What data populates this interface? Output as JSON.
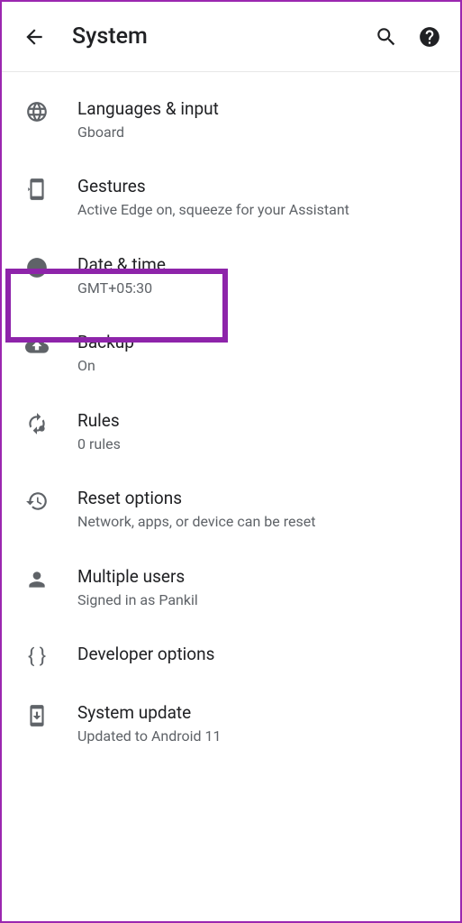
{
  "header": {
    "title": "System"
  },
  "items": [
    {
      "id": "languages",
      "title": "Languages & input",
      "subtitle": "Gboard"
    },
    {
      "id": "gestures",
      "title": "Gestures",
      "subtitle": "Active Edge on, squeeze for your Assistant"
    },
    {
      "id": "datetime",
      "title": "Date & time",
      "subtitle": "GMT+05:30"
    },
    {
      "id": "backup",
      "title": "Backup",
      "subtitle": "On"
    },
    {
      "id": "rules",
      "title": "Rules",
      "subtitle": "0 rules"
    },
    {
      "id": "reset",
      "title": "Reset options",
      "subtitle": "Network, apps, or device can be reset"
    },
    {
      "id": "users",
      "title": "Multiple users",
      "subtitle": "Signed in as Pankil"
    },
    {
      "id": "developer",
      "title": "Developer options",
      "subtitle": ""
    },
    {
      "id": "update",
      "title": "System update",
      "subtitle": "Updated to Android 11"
    }
  ]
}
